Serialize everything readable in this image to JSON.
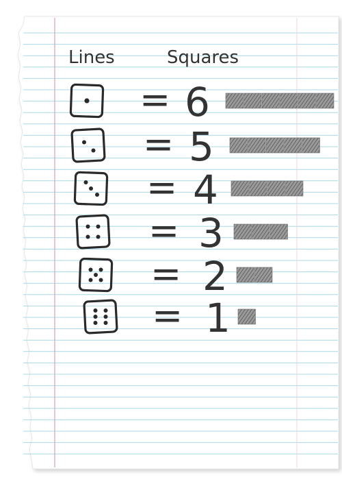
{
  "header": {
    "left_label": "Lines",
    "right_label": "Squares"
  },
  "rows": [
    {
      "dice_pips": 1,
      "equals": "=",
      "number": "6",
      "squares": 6
    },
    {
      "dice_pips": 2,
      "equals": "=",
      "number": "5",
      "squares": 5
    },
    {
      "dice_pips": 3,
      "equals": "=",
      "number": "4",
      "squares": 4
    },
    {
      "dice_pips": 4,
      "equals": "=",
      "number": "3",
      "squares": 3
    },
    {
      "dice_pips": 5,
      "equals": "=",
      "number": "2",
      "squares": 2
    },
    {
      "dice_pips": 6,
      "equals": "=",
      "number": "1",
      "squares": 1
    }
  ],
  "colors": {
    "paper": "#ffffff",
    "rule_line": "#a9d8e6",
    "margin_line": "#d9a6c8",
    "ink": "#2a2a2a",
    "pencil_fill": "#7a7a7a"
  }
}
